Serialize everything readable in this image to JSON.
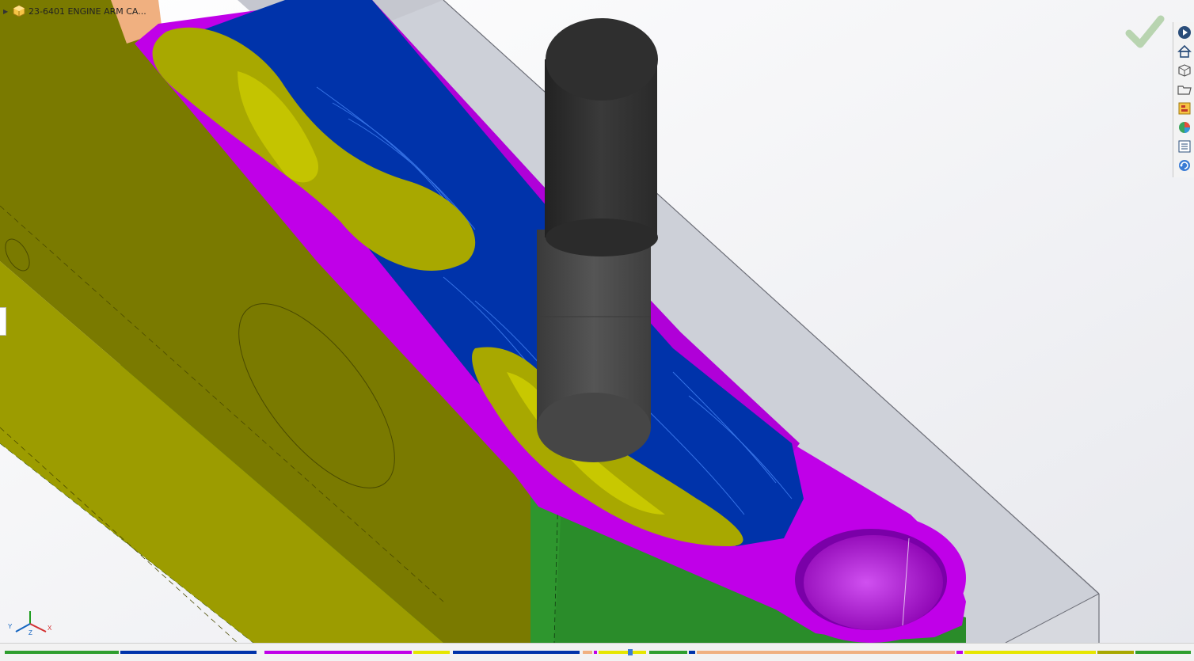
{
  "document": {
    "title": "23-6401 ENGINE ARM CA..."
  },
  "colors": {
    "stock_yellow": "#7a7a00",
    "stock_yellow_light": "#a8a800",
    "floor_green": "#248024",
    "wall_magenta": "#c000e8",
    "toolpath_blue": "#0033aa",
    "tool_dark": "#2d2d2d",
    "tool_mid": "#4a4a4a",
    "block_grey": "#cfd1d8",
    "accept_green": "#b8d4b0"
  },
  "toolbar": {
    "right_icons": [
      "play-icon",
      "home-icon",
      "view-cube-icon",
      "open-folder-icon",
      "layout-icon",
      "appearance-icon",
      "list-icon",
      "refresh-icon"
    ]
  },
  "triad": {
    "x_label": "X",
    "y_label": "Y",
    "z_label": "Z"
  },
  "timeline": {
    "marker_position": 0.528
  }
}
